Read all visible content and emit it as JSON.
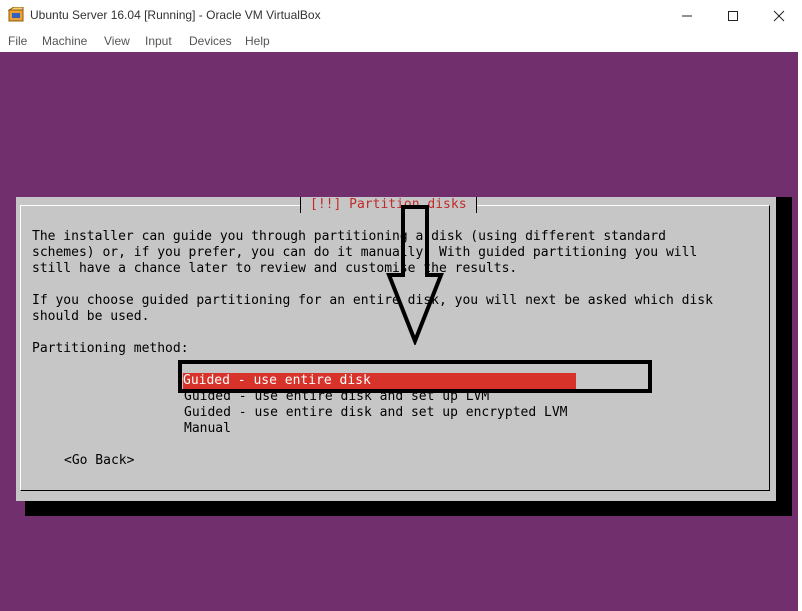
{
  "window": {
    "title": "Ubuntu Server 16.04 [Running] - Oracle VM VirtualBox",
    "app_icon": "virtualbox-icon",
    "controls": [
      "minimize-icon",
      "maximize-icon",
      "close-icon"
    ]
  },
  "menu": {
    "items": [
      "File",
      "Machine",
      "View",
      "Input",
      "Devices",
      "Help"
    ]
  },
  "installer": {
    "dialog_title": "[!!] Partition disks",
    "description_lines": [
      "The installer can guide you through partitioning a disk (using different standard",
      "schemes) or, if you prefer, you can do it manually. With guided partitioning you will",
      "still have a chance later to review and customise the results.",
      "If you choose guided partitioning for an entire disk, you will next be asked which disk",
      "should be used."
    ],
    "method_label": "Partitioning method:",
    "options": [
      "Guided - use entire disk",
      "Guided - use entire disk and set up LVM",
      "Guided - use entire disk and set up encrypted LVM",
      "Manual"
    ],
    "selected_option": "Guided - use entire disk",
    "go_back_label": "<Go Back>"
  },
  "colors": {
    "desktop_background": "#722f6d",
    "dialog_background": "#c6c6c6",
    "selection_highlight": "#d8332a",
    "title_text": "#c02a2a",
    "annotation": "#000000"
  },
  "annotation": {
    "arrow_icon": "down-arrow-icon",
    "box": "selection-highlight-box"
  }
}
